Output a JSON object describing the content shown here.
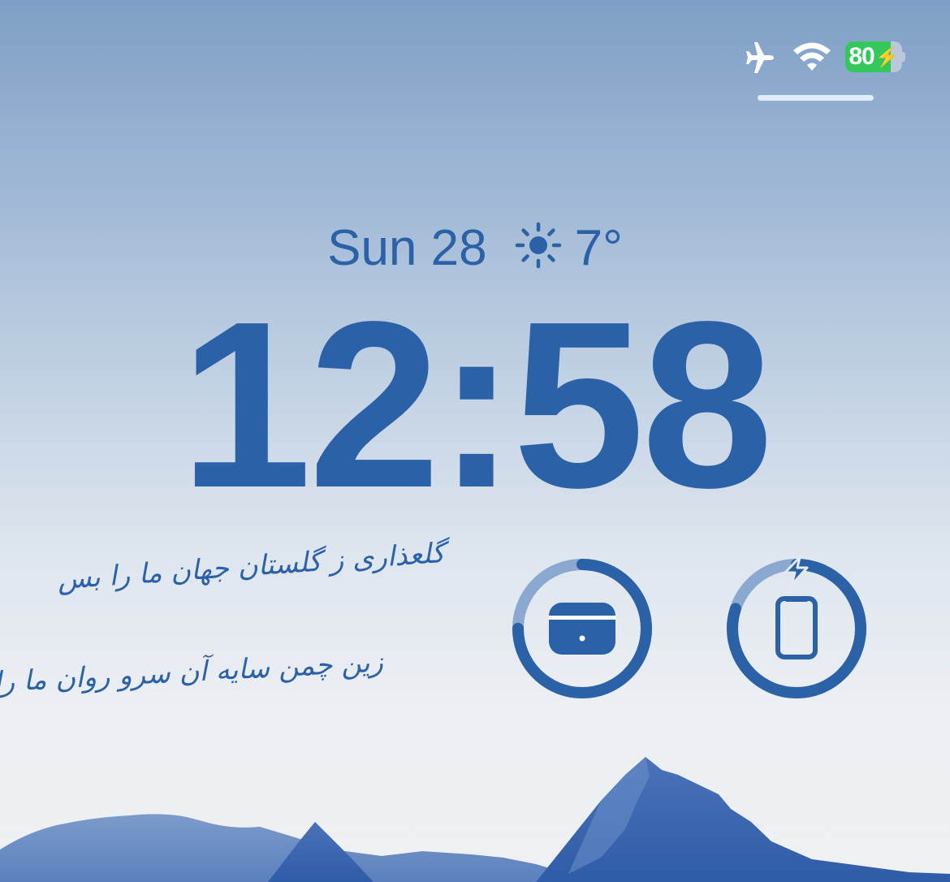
{
  "status_bar": {
    "icons": [
      "airplane-icon",
      "wifi-icon",
      "battery-icon"
    ],
    "battery_percent": 80,
    "battery_label": "80",
    "charging": true,
    "battery_fill_color": "#34c759"
  },
  "lock_screen": {
    "date": "Sun 28",
    "weather_icon": "sun-icon",
    "temperature": "7°",
    "time": "12:58",
    "accent_color": "#2b62a7"
  },
  "poem": {
    "line1": "گلعذاری ز گلستان جهان ما را بس",
    "line2": "زین چمن سایه آن سرو روان ما را بس"
  },
  "widgets": [
    {
      "name": "earbuds-battery",
      "icon": "earbuds-case-icon",
      "level": 0.75
    },
    {
      "name": "phone-battery",
      "icon": "iphone-icon",
      "level": 0.8,
      "charging_icon": "bolt-icon"
    }
  ]
}
